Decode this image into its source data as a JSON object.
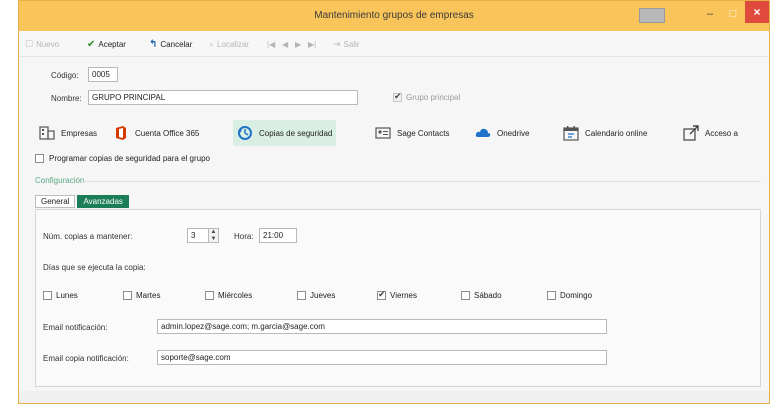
{
  "window": {
    "title": "Mantenimiento grupos de empresas",
    "controls": {
      "minimize": "–",
      "maximize": "□",
      "close": "×"
    }
  },
  "toolbar": {
    "nuevo": "Nuevo",
    "aceptar": "Aceptar",
    "cancelar": "Cancelar",
    "localizar": "Localizar",
    "salir": "Salir",
    "nav_first": "|◀",
    "nav_prev": "◀",
    "nav_next": "▶",
    "nav_last": "▶|"
  },
  "form": {
    "codigo_label": "Código:",
    "codigo_value": "0005",
    "nombre_label": "Nombre:",
    "nombre_value": "GRUPO PRINCIPAL",
    "grupo_principal_label": "Grupo principal",
    "grupo_principal_checked": true
  },
  "modules": [
    {
      "label": "Empresas",
      "icon": "companies-icon"
    },
    {
      "label": "Cuenta Office 365",
      "icon": "office-icon"
    },
    {
      "label": "Copias de seguridad",
      "icon": "backup-icon",
      "active": true
    },
    {
      "label": "Sage Contacts",
      "icon": "contacts-icon"
    },
    {
      "label": "Onedrive",
      "icon": "cloud-icon"
    },
    {
      "label": "Calendario online",
      "icon": "calendar-icon"
    },
    {
      "label": "Acceso a",
      "icon": "external-link-icon"
    }
  ],
  "backup": {
    "programar_label": "Programar copias de seguridad para el grupo",
    "programar_checked": false,
    "section_title": "Configuración",
    "tabs": [
      "General",
      "Avanzadas"
    ],
    "active_tab": "Avanzadas",
    "num_copias_label": "Núm. copias a mantener:",
    "num_copias_value": "3",
    "hora_label": "Hora:",
    "hora_value": "21:00",
    "dias_label": "Días que se ejecuta la copia:",
    "days": [
      {
        "label": "Lunes",
        "checked": false
      },
      {
        "label": "Martes",
        "checked": false
      },
      {
        "label": "Miércoles",
        "checked": false
      },
      {
        "label": "Jueves",
        "checked": false
      },
      {
        "label": "Viernes",
        "checked": true
      },
      {
        "label": "Sábado",
        "checked": false
      },
      {
        "label": "Domingo",
        "checked": false
      }
    ],
    "email_notif_label": "Email notificación:",
    "email_notif_value": "admin.lopez@sage.com; m.garcia@sage.com",
    "email_copia_label": "Email copia notificación:",
    "email_copia_value": "soporte@sage.com"
  },
  "colors": {
    "titlebar": "#f9c55a",
    "close_button": "#e04a3c",
    "accent_green": "#1b7e58",
    "active_module_bg": "#d9efe4",
    "office_red": "#d83b01",
    "onedrive_blue": "#1e73c8"
  }
}
